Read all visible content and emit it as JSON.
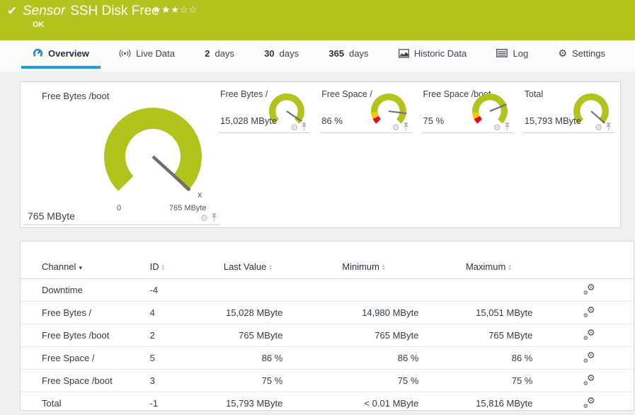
{
  "header": {
    "title_prefix": "Sensor",
    "title": "SSH Disk Free",
    "status": "OK",
    "stars_filled": 3,
    "stars_total": 5
  },
  "tabs": [
    {
      "label": "Overview",
      "icon": "gauge-icon",
      "active": true
    },
    {
      "label": "Live Data",
      "icon": "live-icon"
    },
    {
      "num": "2",
      "label": "days"
    },
    {
      "num": "30",
      "label": "days"
    },
    {
      "num": "365",
      "label": "days"
    },
    {
      "label": "Historic Data",
      "icon": "area-chart-icon"
    },
    {
      "label": "Log",
      "icon": "log-icon"
    },
    {
      "label": "Settings",
      "icon": "gear-icon"
    }
  ],
  "colors": {
    "brand_green": "#b4c21e",
    "accent_blue": "#1b9ed9",
    "gauge_green": "#b2c31c",
    "gauge_yellow": "#fdc400",
    "gauge_red": "#e30613",
    "needle_gray": "#6e6e6e"
  },
  "main_gauge": {
    "title": "Free Bytes /boot",
    "value": "765 MByte",
    "scale_min": "0",
    "scale_max": "765 MByte",
    "percent": 0.99,
    "tip_marker": "x",
    "segments": [
      [
        0,
        1,
        "#b2c31c"
      ]
    ]
  },
  "mini_gauges": [
    {
      "title": "Free Bytes /",
      "value": "15,028 MByte",
      "percent": 0.96,
      "segments": [
        [
          0,
          1,
          "#b2c31c"
        ]
      ]
    },
    {
      "title": "Free Space /",
      "value": "86 %",
      "percent": 0.86,
      "segments": [
        [
          0,
          0.07,
          "#e30613"
        ],
        [
          0.07,
          0.15,
          "#fdc400"
        ],
        [
          0.15,
          1,
          "#b2c31c"
        ]
      ]
    },
    {
      "title": "Free Space /boot",
      "value": "75 %",
      "percent": 0.75,
      "segments": [
        [
          0,
          0.07,
          "#e30613"
        ],
        [
          0.07,
          0.15,
          "#fdc400"
        ],
        [
          0.15,
          1,
          "#b2c31c"
        ]
      ]
    },
    {
      "title": "Total",
      "value": "15,793 MByte",
      "percent": 0.985,
      "segments": [
        [
          0,
          1,
          "#b2c31c"
        ]
      ]
    }
  ],
  "table": {
    "columns": {
      "channel": "Channel",
      "id": "ID",
      "last": "Last Value",
      "min": "Minimum",
      "max": "Maximum"
    },
    "sorted_by": "Channel",
    "rows": [
      {
        "channel": "Downtime",
        "id": "-4",
        "last": "",
        "min": "",
        "max": ""
      },
      {
        "channel": "Free Bytes /",
        "id": "4",
        "last": "15,028 MByte",
        "min": "14,980 MByte",
        "max": "15,051 MByte"
      },
      {
        "channel": "Free Bytes /boot",
        "id": "2",
        "last": "765 MByte",
        "min": "765 MByte",
        "max": "765 MByte"
      },
      {
        "channel": "Free Space /",
        "id": "5",
        "last": "86 %",
        "min": "86 %",
        "max": "86 %"
      },
      {
        "channel": "Free Space /boot",
        "id": "3",
        "last": "75 %",
        "min": "75 %",
        "max": "75 %"
      },
      {
        "channel": "Total",
        "id": "-1",
        "last": "15,793 MByte",
        "min": "< 0.01 MByte",
        "max": "15,816 MByte"
      }
    ]
  }
}
